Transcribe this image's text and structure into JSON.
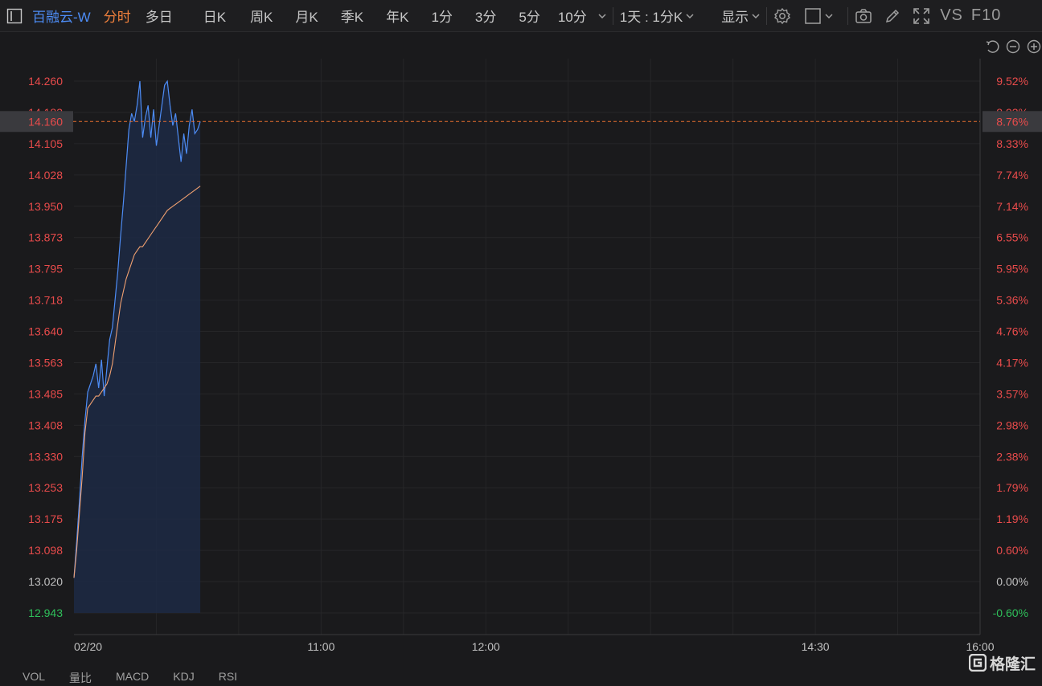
{
  "toolbar": {
    "symbol": "百融云-W",
    "tabs": [
      {
        "label": "分时",
        "active": true
      },
      {
        "label": "多日",
        "active": false
      },
      {
        "label": "日K",
        "active": false
      },
      {
        "label": "周K",
        "active": false
      },
      {
        "label": "月K",
        "active": false
      },
      {
        "label": "季K",
        "active": false
      },
      {
        "label": "年K",
        "active": false
      },
      {
        "label": "1分",
        "active": false
      },
      {
        "label": "3分",
        "active": false
      },
      {
        "label": "5分",
        "active": false
      }
    ],
    "interval_select": "10分",
    "range_select": "1天 : 1分K",
    "display_select": "显示",
    "vs_label": "VS",
    "f10_label": "F10"
  },
  "colors": {
    "up": "#e84b4b",
    "down": "#2fbf5a",
    "price_line": "#4d8cf5",
    "avg_line": "#f0a070",
    "current_line": "#e86e2e",
    "active_tab": "#f0803c"
  },
  "chart_data": {
    "type": "line",
    "y_ticks": [
      "14.260",
      "14.183",
      "14.105",
      "14.028",
      "13.950",
      "13.873",
      "13.795",
      "13.718",
      "13.640",
      "13.563",
      "13.485",
      "13.408",
      "13.330",
      "13.253",
      "13.175",
      "13.098",
      "13.020",
      "12.943"
    ],
    "pct_ticks": [
      "9.52%",
      "8.93%",
      "8.33%",
      "7.74%",
      "7.14%",
      "6.55%",
      "5.95%",
      "5.36%",
      "4.76%",
      "4.17%",
      "3.57%",
      "2.98%",
      "2.38%",
      "1.79%",
      "1.19%",
      "0.60%",
      "0.00%",
      "-0.60%"
    ],
    "x_labels": [
      "02/20",
      "11:00",
      "12:00",
      "14:30",
      "16:00"
    ],
    "x_label_minutes": [
      0,
      90,
      150,
      270,
      330
    ],
    "ylim": [
      12.943,
      14.26
    ],
    "ref_price": 13.02,
    "current_price": "14.160",
    "current_pct": "8.76%",
    "price": [
      [
        0,
        13.03
      ],
      [
        1,
        13.12
      ],
      [
        2,
        13.22
      ],
      [
        3,
        13.33
      ],
      [
        4,
        13.42
      ],
      [
        5,
        13.49
      ],
      [
        6,
        13.51
      ],
      [
        7,
        13.53
      ],
      [
        8,
        13.56
      ],
      [
        9,
        13.5
      ],
      [
        10,
        13.57
      ],
      [
        11,
        13.48
      ],
      [
        12,
        13.55
      ],
      [
        13,
        13.62
      ],
      [
        14,
        13.65
      ],
      [
        15,
        13.72
      ],
      [
        16,
        13.79
      ],
      [
        17,
        13.88
      ],
      [
        18,
        13.96
      ],
      [
        19,
        14.05
      ],
      [
        20,
        14.14
      ],
      [
        21,
        14.18
      ],
      [
        22,
        14.16
      ],
      [
        23,
        14.2
      ],
      [
        24,
        14.26
      ],
      [
        25,
        14.12
      ],
      [
        26,
        14.17
      ],
      [
        27,
        14.2
      ],
      [
        28,
        14.12
      ],
      [
        29,
        14.19
      ],
      [
        30,
        14.1
      ],
      [
        31,
        14.15
      ],
      [
        32,
        14.2
      ],
      [
        33,
        14.25
      ],
      [
        34,
        14.26
      ],
      [
        35,
        14.2
      ],
      [
        36,
        14.15
      ],
      [
        37,
        14.18
      ],
      [
        38,
        14.12
      ],
      [
        39,
        14.06
      ],
      [
        40,
        14.13
      ],
      [
        41,
        14.08
      ],
      [
        42,
        14.15
      ],
      [
        43,
        14.19
      ],
      [
        44,
        14.13
      ],
      [
        45,
        14.14
      ],
      [
        46,
        14.16
      ]
    ],
    "avg": [
      [
        0,
        13.03
      ],
      [
        1,
        13.1
      ],
      [
        2,
        13.19
      ],
      [
        3,
        13.28
      ],
      [
        4,
        13.39
      ],
      [
        5,
        13.45
      ],
      [
        6,
        13.46
      ],
      [
        7,
        13.47
      ],
      [
        8,
        13.48
      ],
      [
        9,
        13.48
      ],
      [
        10,
        13.49
      ],
      [
        11,
        13.5
      ],
      [
        12,
        13.51
      ],
      [
        13,
        13.53
      ],
      [
        14,
        13.56
      ],
      [
        15,
        13.61
      ],
      [
        16,
        13.66
      ],
      [
        17,
        13.71
      ],
      [
        18,
        13.74
      ],
      [
        19,
        13.77
      ],
      [
        20,
        13.79
      ],
      [
        21,
        13.81
      ],
      [
        22,
        13.83
      ],
      [
        23,
        13.84
      ],
      [
        24,
        13.85
      ],
      [
        25,
        13.85
      ],
      [
        26,
        13.86
      ],
      [
        27,
        13.87
      ],
      [
        28,
        13.88
      ],
      [
        29,
        13.89
      ],
      [
        30,
        13.9
      ],
      [
        31,
        13.91
      ],
      [
        32,
        13.92
      ],
      [
        33,
        13.93
      ],
      [
        34,
        13.94
      ],
      [
        35,
        13.945
      ],
      [
        36,
        13.95
      ],
      [
        37,
        13.955
      ],
      [
        38,
        13.96
      ],
      [
        39,
        13.965
      ],
      [
        40,
        13.97
      ],
      [
        41,
        13.975
      ],
      [
        42,
        13.98
      ],
      [
        43,
        13.985
      ],
      [
        44,
        13.99
      ],
      [
        45,
        13.995
      ],
      [
        46,
        14.0
      ]
    ]
  },
  "bottom_tabs": [
    "VOL",
    "量比",
    "MACD",
    "KDJ",
    "RSI"
  ],
  "logo_text": "格隆汇"
}
